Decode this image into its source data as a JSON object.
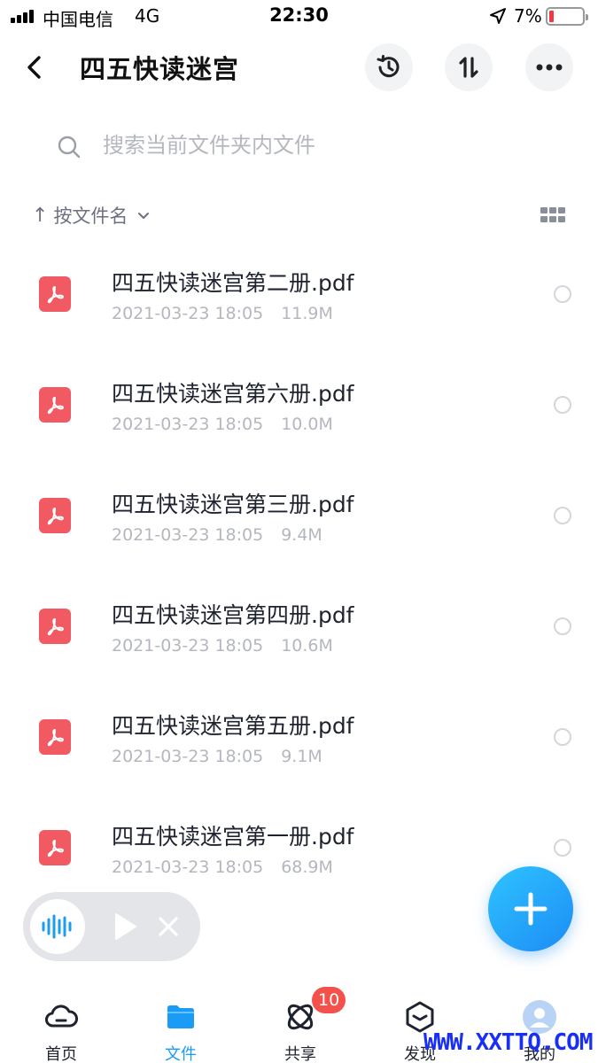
{
  "status_bar": {
    "carrier": "中国电信",
    "network": "4G",
    "time": "22:30",
    "battery_percent": "7%",
    "battery_level": 0.07
  },
  "header": {
    "title": "四五快读迷宫",
    "icons": [
      "back-arrow-icon",
      "history-icon",
      "sort-icon",
      "more-icon"
    ]
  },
  "search": {
    "placeholder": "搜索当前文件夹内文件"
  },
  "sort": {
    "arrow": "↑",
    "label": "按文件名"
  },
  "files": [
    {
      "name": "四五快读迷宫第二册.pdf",
      "date": "2021-03-23 18:05",
      "size": "11.9M"
    },
    {
      "name": "四五快读迷宫第六册.pdf",
      "date": "2021-03-23 18:05",
      "size": "10.0M"
    },
    {
      "name": "四五快读迷宫第三册.pdf",
      "date": "2021-03-23 18:05",
      "size": "9.4M"
    },
    {
      "name": "四五快读迷宫第四册.pdf",
      "date": "2021-03-23 18:05",
      "size": "10.6M"
    },
    {
      "name": "四五快读迷宫第五册.pdf",
      "date": "2021-03-23 18:05",
      "size": "9.1M"
    },
    {
      "name": "四五快读迷宫第一册.pdf",
      "date": "2021-03-23 18:05",
      "size": "68.9M"
    }
  ],
  "tabs": [
    {
      "label": "首页",
      "icon": "cloud-icon",
      "active": false
    },
    {
      "label": "文件",
      "icon": "folder-icon",
      "active": true
    },
    {
      "label": "共享",
      "icon": "orbit-icon",
      "active": false
    },
    {
      "label": "发现",
      "icon": "box-icon",
      "active": false
    },
    {
      "label": "我的",
      "icon": "avatar-icon",
      "active": false
    }
  ],
  "share_badge": "10",
  "watermark": "WWW.XXTTQ.COM",
  "colors": {
    "accent": "#1a9bf5",
    "pdf_icon": "#f15a63",
    "badge": "#f4504c",
    "battery_low": "#f2393b"
  }
}
